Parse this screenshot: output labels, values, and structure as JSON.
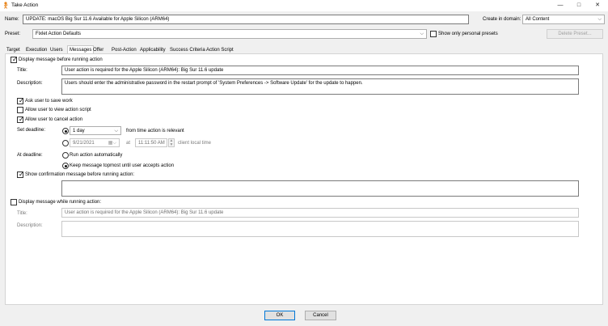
{
  "window": {
    "title": "Take Action",
    "minimize_glyph": "—",
    "maximize_glyph": "□",
    "close_glyph": "✕"
  },
  "header": {
    "name_label": "Name:",
    "name_value": "UPDATE: macOS Big Sur 11.6 Available for Apple Silicon (ARM64)",
    "create_domain_label": "Create in domain:",
    "create_domain_value": "All Content",
    "preset_label": "Preset:",
    "preset_value": "Fixlet Action Defaults",
    "show_personal_label": "Show only personal presets",
    "delete_preset_label": "Delete Preset..."
  },
  "tabs": [
    "Target",
    "Execution",
    "Users",
    "Messages",
    "Offer",
    "Post-Action",
    "Applicability",
    "Success Criteria",
    "Action Script"
  ],
  "active_tab": "Messages",
  "messages": {
    "display_before_label": "Display message before running action",
    "title_label": "Title:",
    "title_value": "User action is required for the Apple Silicon (ARM64): Big Sur 11.6 update",
    "description_label": "Description:",
    "description_value": "Users should enter the administrative password in the restart prompt of 'System Preferences -> Software Update' for the update to happen.",
    "ask_save_label": "Ask user to save work",
    "allow_view_label": "Allow user to view action script",
    "allow_cancel_label": "Allow user to cancel action",
    "set_deadline_label": "Set deadline:",
    "deadline_interval": "1 day",
    "from_time_label": "from time action is relevant",
    "deadline_date": "9/21/2021",
    "at_label": "at",
    "deadline_time": "11:11:50 AM",
    "client_time_label": "client local time",
    "at_deadline_label": "At deadline:",
    "run_auto_label": "Run action automatically",
    "keep_topmost_label": "Keep message topmost until user accepts action",
    "show_confirm_label": "Show confirmation message before running action:",
    "confirm_value": "",
    "display_while_label": "Display message while running action:",
    "while_title_label": "Title:",
    "while_title_value": "User action is required for the Apple Silicon (ARM64): Big Sur 11.6 update",
    "while_description_label": "Description:",
    "while_description_value": ""
  },
  "footer": {
    "ok_label": "OK",
    "cancel_label": "Cancel"
  },
  "colors": {
    "accent": "#0078d7",
    "icon_orange": "#e8841a"
  }
}
